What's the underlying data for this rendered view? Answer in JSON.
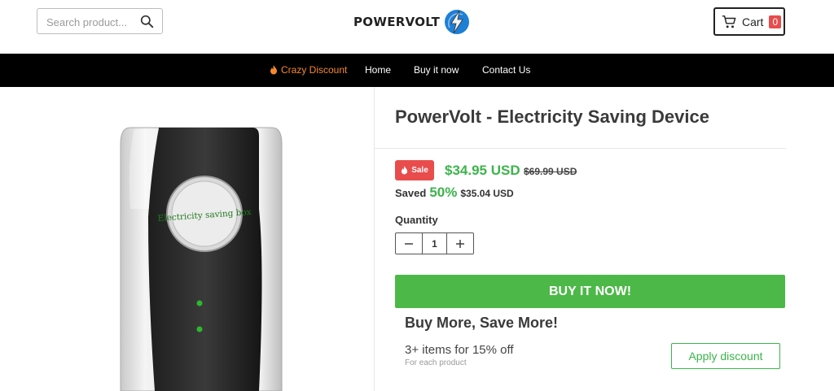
{
  "header": {
    "search_placeholder": "Search product...",
    "logo_text": "POWERVOLT",
    "cart_label": "Cart",
    "cart_count": "0"
  },
  "nav": {
    "items": [
      {
        "label": "Crazy Discount",
        "icon": "fire-icon",
        "color": "#f7892c"
      },
      {
        "label": "Home"
      },
      {
        "label": "Buy it now"
      },
      {
        "label": "Contact Us"
      }
    ]
  },
  "product": {
    "title": "PowerVolt - Electricity Saving Device",
    "image_label": "Electricity saving box",
    "sale_badge": "Sale",
    "price_now": "$34.95 USD",
    "price_old": "$69.99 USD",
    "saved_label": "Saved",
    "saved_percent": "50%",
    "saved_amount": "$35.04 USD",
    "quantity_label": "Quantity",
    "quantity_value": "1",
    "buy_button": "BUY IT NOW!"
  },
  "bundle": {
    "title": "Buy More, Save More!",
    "offer": "3+ items for 15% off",
    "offer_sub": "For each product",
    "apply_button": "Apply discount"
  },
  "colors": {
    "accent_green": "#4cb848",
    "sale_red": "#e84c4c",
    "nav_bg": "#000000",
    "discount_orange": "#f7892c"
  }
}
